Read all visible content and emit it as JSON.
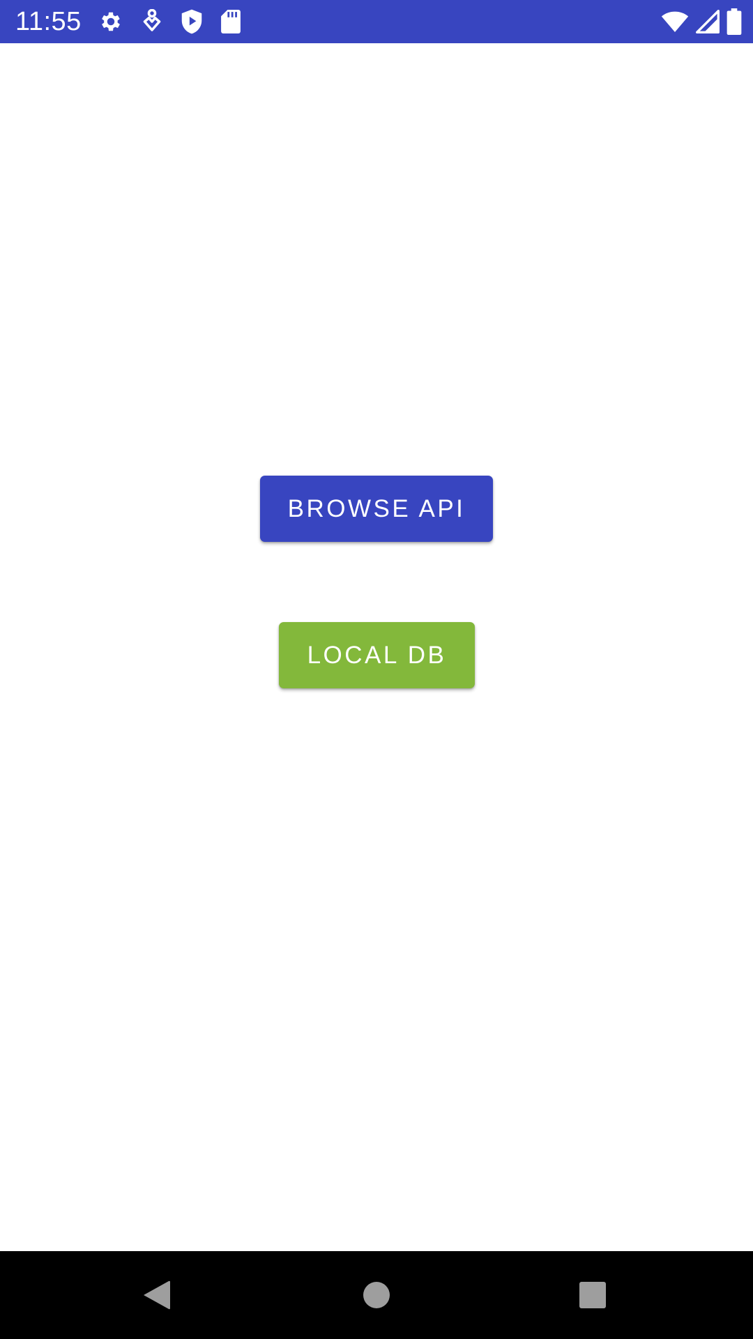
{
  "status_bar": {
    "time": "11:55",
    "background_color": "#3845c0",
    "left_icons": [
      "settings-icon",
      "location-pin-icon",
      "play-shield-icon",
      "sd-card-icon"
    ],
    "right_icons": [
      "wifi-icon",
      "cellular-signal-icon",
      "battery-icon"
    ]
  },
  "main": {
    "browse_button_label": "BROWSE API",
    "browse_button_color": "#3845c0",
    "local_button_label": "LOCAL DB",
    "local_button_color": "#83b83b"
  },
  "nav_bar": {
    "icons": [
      "back-icon",
      "home-icon",
      "recents-icon"
    ]
  }
}
